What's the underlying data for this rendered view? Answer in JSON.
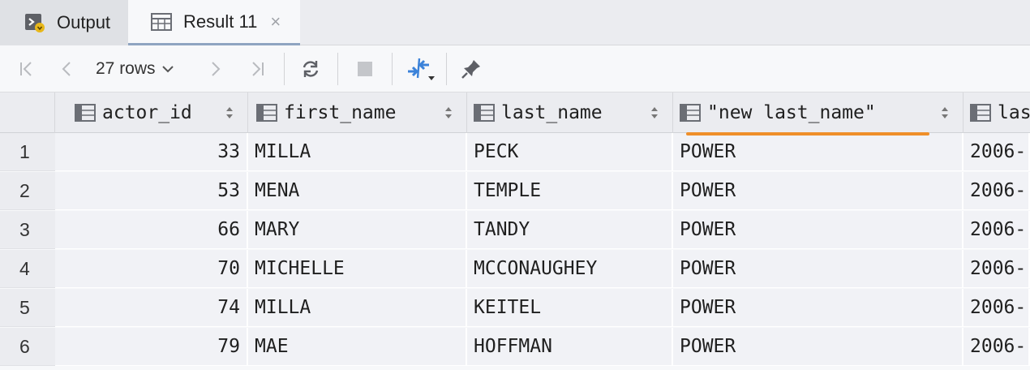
{
  "tabs": {
    "output": {
      "label": "Output",
      "icon": "console-output-icon"
    },
    "result": {
      "label": "Result 11",
      "icon": "table-icon",
      "close": "×"
    }
  },
  "toolbar": {
    "rows_label": "27 rows",
    "buttons": [
      "first-page-icon",
      "prev-page-icon",
      "next-page-icon",
      "last-page-icon",
      "refresh-icon",
      "stop-icon",
      "compare-icon",
      "pin-icon"
    ]
  },
  "grid": {
    "columns": [
      "actor_id",
      "first_name",
      "last_name",
      "\"new last_name\"",
      "las"
    ],
    "highlight_color": "#ef8f2a",
    "rows": [
      {
        "n": "1",
        "actor_id": "33",
        "first_name": "MILLA",
        "last_name": "PECK",
        "new_last_name": "POWER",
        "last": "2006-"
      },
      {
        "n": "2",
        "actor_id": "53",
        "first_name": "MENA",
        "last_name": "TEMPLE",
        "new_last_name": "POWER",
        "last": "2006-"
      },
      {
        "n": "3",
        "actor_id": "66",
        "first_name": "MARY",
        "last_name": "TANDY",
        "new_last_name": "POWER",
        "last": "2006-"
      },
      {
        "n": "4",
        "actor_id": "70",
        "first_name": "MICHELLE",
        "last_name": "MCCONAUGHEY",
        "new_last_name": "POWER",
        "last": "2006-"
      },
      {
        "n": "5",
        "actor_id": "74",
        "first_name": "MILLA",
        "last_name": "KEITEL",
        "new_last_name": "POWER",
        "last": "2006-"
      },
      {
        "n": "6",
        "actor_id": "79",
        "first_name": "MAE",
        "last_name": "HOFFMAN",
        "new_last_name": "POWER",
        "last": "2006-"
      }
    ]
  }
}
